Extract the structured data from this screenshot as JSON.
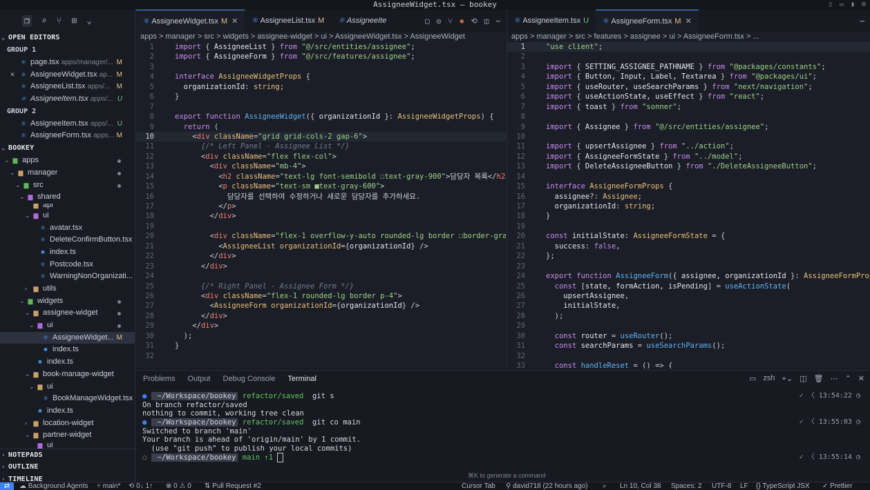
{
  "window": {
    "title": "AssigneeWidget.tsx — bookey"
  },
  "sidebar": {
    "open_editors": "OPEN EDITORS",
    "group1": "GROUP 1",
    "group1_items": [
      {
        "name": "page.tsx",
        "path": "apps/manager/...",
        "status": "M"
      },
      {
        "name": "AssigneeWidget.tsx",
        "path": "ap...",
        "status": "M"
      },
      {
        "name": "AssigneeList.tsx",
        "path": "apps/...",
        "status": "M"
      },
      {
        "name": "AssigneeItem.tsx",
        "path": "apps/...",
        "status": "U"
      }
    ],
    "group2": "GROUP 2",
    "group2_items": [
      {
        "name": "AssigneeItem.tsx",
        "path": "apps/...",
        "status": "U"
      },
      {
        "name": "AssigneeForm.tsx",
        "path": "apps...",
        "status": "M"
      }
    ],
    "project": "BOOKEY",
    "tree": [
      {
        "label": "apps"
      },
      {
        "label": "manager"
      },
      {
        "label": "src"
      },
      {
        "label": "shared"
      },
      {
        "label": "api"
      },
      {
        "label": "ui"
      },
      {
        "label": "avatar.tsx"
      },
      {
        "label": "DeleteConfirmButton.tsx"
      },
      {
        "label": "index.ts"
      },
      {
        "label": "Postcode.tsx"
      },
      {
        "label": "WarningNonOrganizati..."
      },
      {
        "label": "utils"
      },
      {
        "label": "widgets"
      },
      {
        "label": "assignee-widget"
      },
      {
        "label": "ui"
      },
      {
        "label": "AssigneeWidget...",
        "status": "M"
      },
      {
        "label": "index.ts"
      },
      {
        "label": "index.ts"
      },
      {
        "label": "book-manage-widget"
      },
      {
        "label": "ui"
      },
      {
        "label": "BookManageWidget.tsx"
      },
      {
        "label": "index.ts"
      },
      {
        "label": "location-widget"
      },
      {
        "label": "partner-widget"
      },
      {
        "label": "ui"
      }
    ],
    "notepads": "NOTEPADS",
    "outline": "OUTLINE",
    "timeline": "TIMELINE"
  },
  "left_editor": {
    "tabs": [
      {
        "name": "AssigneeWidget.tsx",
        "status": "M"
      },
      {
        "name": "AssigneeList.tsx",
        "status": "M"
      },
      {
        "name": "AssigneeIte",
        "status": ""
      }
    ],
    "breadcrumb": "apps > manager > src > widgets > assignee-widget > ui > AssigneeWidget.tsx > AssigneeWidget"
  },
  "right_editor": {
    "tabs": [
      {
        "name": "AssigneeItem.tsx",
        "status": "U"
      },
      {
        "name": "AssigneeForm.tsx",
        "status": "M"
      }
    ],
    "breadcrumb": "apps > manager > src > features > assignee > ui > AssigneeForm.tsx > ..."
  },
  "panel": {
    "tabs": [
      "Problems",
      "Output",
      "Debug Console",
      "Terminal"
    ],
    "shell": "zsh",
    "path": "~/Workspace/bookey",
    "branch1": "refactor/saved",
    "branch2": "main ↑1",
    "cmd1": "git s",
    "cmd2": "git co main",
    "out1": "On branch refactor/saved",
    "out2": "nothing to commit, working tree clean",
    "out3": "Switched to branch 'main'",
    "out4": "Your branch is ahead of 'origin/main' by 1 commit.",
    "out5": "  (use \"git push\" to publish your local commits)",
    "time1": "13:54:22",
    "time2": "13:55:03",
    "time3": "13:55:14",
    "hint": "⌘K to generate a command"
  },
  "statusbar": {
    "agents": "Background Agents",
    "branch": "main*",
    "sync": "0↓ 1↑",
    "problems": "0 ⚠ 0",
    "pr": "Pull Request #2",
    "cursor_tab": "Cursor Tab",
    "blame": "david718 (22 hours ago)",
    "position": "Ln 10, Col 38",
    "spaces": "Spaces: 2",
    "encoding": "UTF-8",
    "eol": "LF",
    "language": "TypeScript JSX",
    "formatter": "Prettier"
  }
}
